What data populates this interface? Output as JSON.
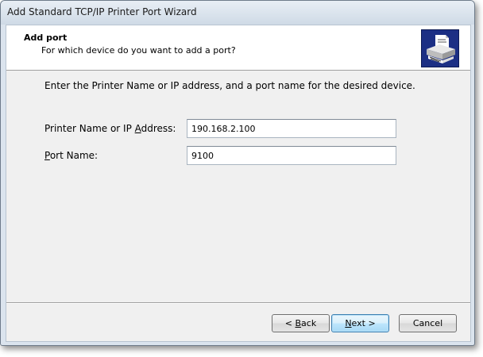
{
  "window": {
    "title": "Add Standard TCP/IP Printer Port Wizard"
  },
  "header": {
    "title": "Add port",
    "subtitle": "For which device do you want to add a port?",
    "icon": "printer-port-icon"
  },
  "instructions": "Enter the Printer Name or IP address, and a port name for the desired device.",
  "fields": {
    "printer_name": {
      "label_pre": "Printer Name or IP ",
      "label_key": "A",
      "label_post": "ddress:",
      "value": "190.168.2.100"
    },
    "port_name": {
      "label_key": "P",
      "label_post": "ort Name:",
      "value": "9100"
    }
  },
  "buttons": {
    "back_prefix": "< ",
    "back_key": "B",
    "back_suffix": "ack",
    "next_key": "N",
    "next_suffix": "ext >",
    "cancel": "Cancel"
  },
  "colors": {
    "icon_background": "#1c2f84",
    "default_button_border": "#3c7fb1"
  }
}
